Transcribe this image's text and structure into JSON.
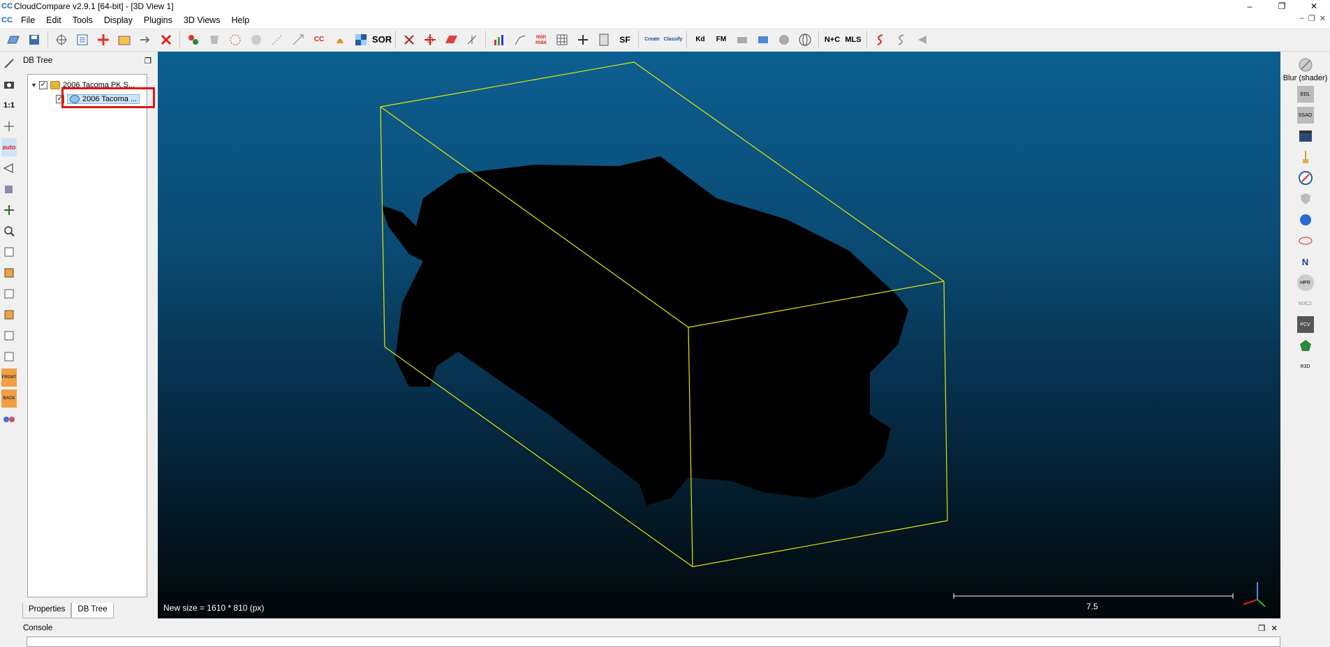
{
  "window": {
    "title": "CloudCompare v2.9.1 [64-bit] - [3D View 1]",
    "app_icon": "CC",
    "minimize": "–",
    "restore": "❐",
    "close": "✕"
  },
  "menubar": {
    "items": [
      "File",
      "Edit",
      "Tools",
      "Display",
      "Plugins",
      "3D Views",
      "Help"
    ],
    "mdi_minimize": "–",
    "mdi_restore": "❐",
    "mdi_close": "✕"
  },
  "toolbar": {
    "sor_label": "SOR",
    "sf_label": "SF",
    "minmax_label": "min max",
    "canupo_create": "Create",
    "canupo_classify": "Classify",
    "kd_label": "Kd",
    "fm_label": "FM",
    "nc_label": "N+C",
    "mls_label": "MLS",
    "cc_label": "CC"
  },
  "lefttools": {
    "one_to_one": "1:1",
    "auto": "auto",
    "front": "FRONT",
    "back": "BACK"
  },
  "dbtree": {
    "title": "DB Tree",
    "float_btn": "❐",
    "root_label": "2006 Tacoma PK S...",
    "child_label": "2006 Tacoma ..."
  },
  "bottom_tabs": {
    "properties": "Properties",
    "dbtree": "DB Tree"
  },
  "viewport": {
    "status_message": "New size = 1610 * 810 (px)",
    "scale_value": "7.5",
    "bbox_color": "#e6e600",
    "bg_top": "#0c5f91",
    "bg_bottom": "#020608"
  },
  "righttools": {
    "blur_label": "Blur (shader)",
    "edl": "EDL",
    "ssao": "SSAO",
    "north": "N",
    "hpr": "HPR",
    "m3c2": "M3C2",
    "pcv": "PCV",
    "rsd": "R3D"
  },
  "console": {
    "title": "Console",
    "float_btn": "❐",
    "close_btn": "✕",
    "first_line": ""
  }
}
